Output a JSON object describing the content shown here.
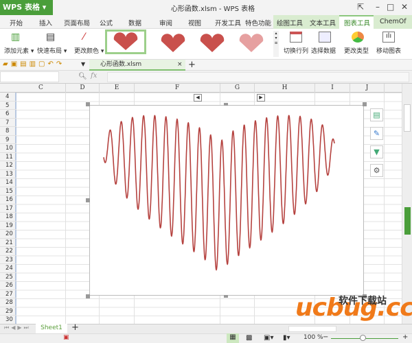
{
  "app": {
    "logo": "WPS 表格",
    "title": "心形函数.xlsm - WPS 表格"
  },
  "menu": [
    "开始",
    "插入",
    "页面布局",
    "公式",
    "数据",
    "审阅",
    "视图",
    "开发工具",
    "特色功能",
    "绘图工具",
    "文本工具",
    "图表工具",
    "ChemOf"
  ],
  "ribbon": {
    "add_element": "添加元素 ▾",
    "quick_layout": "快速布局 ▾",
    "change_color": "更改颜色 ▾",
    "switch_rowcol": "切换行列",
    "select_data": "选择数据",
    "change_type": "更改类型",
    "move_chart": "移动图表"
  },
  "doc_tab": {
    "name": "心形函数.xlsm",
    "close": "×",
    "new": "+"
  },
  "formula_bar": {
    "fx": "fx",
    "name_box": "",
    "value": ""
  },
  "columns": [
    "C",
    "D",
    "E",
    "F",
    "G",
    "H",
    "I",
    "J"
  ],
  "rows": [
    "4",
    "5",
    "6",
    "7",
    "8",
    "9",
    "10",
    "11",
    "12",
    "13",
    "14",
    "15",
    "16",
    "17",
    "18",
    "19",
    "20",
    "21",
    "22",
    "23",
    "24",
    "25",
    "26",
    "27",
    "28",
    "29",
    "30"
  ],
  "sheet": {
    "tab": "Sheet1",
    "add": "+"
  },
  "status": {
    "zoom": "100 %"
  },
  "watermark": {
    "brand": "ucbug.cc",
    "text": "软件下载站"
  },
  "colors": {
    "accent": "#4a9e3a",
    "curve": "#b5423f"
  }
}
